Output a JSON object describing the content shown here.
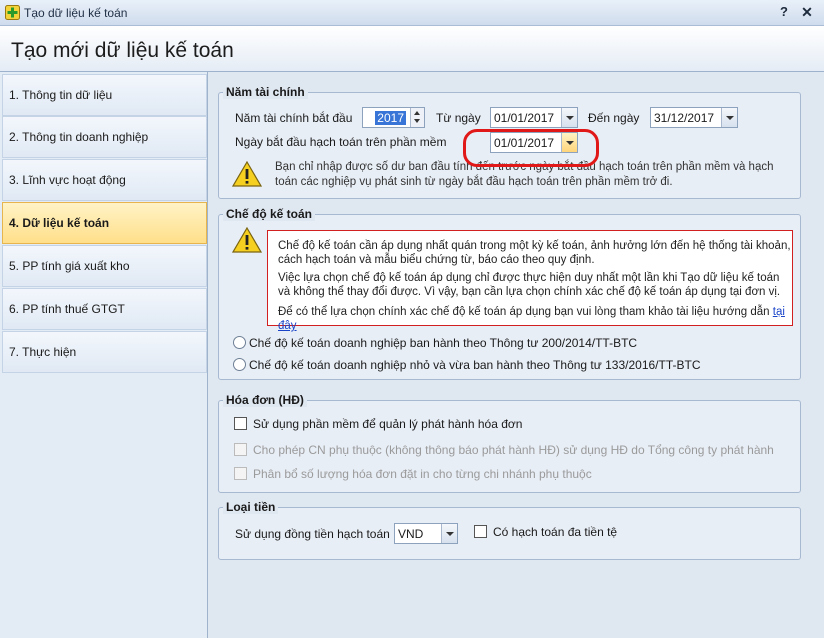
{
  "window": {
    "title": "Tạo dữ liệu kế toán",
    "help": "?",
    "close": "✕"
  },
  "header": {
    "title": "Tạo mới dữ liệu kế toán"
  },
  "steps": [
    {
      "label": "1. Thông tin dữ liệu"
    },
    {
      "label": "2. Thông tin doanh nghiệp"
    },
    {
      "label": "3. Lĩnh vực hoạt động"
    },
    {
      "label": "4. Dữ liệu kế toán"
    },
    {
      "label": "5. PP tính giá xuất kho"
    },
    {
      "label": "6. PP tính thuế GTGT"
    },
    {
      "label": "7. Thực hiện"
    }
  ],
  "fiscal": {
    "title": "Năm tài chính",
    "start_year_label": "Năm tài chính bắt đầu",
    "start_year": "2017",
    "from_label": "Từ ngày",
    "from_date": "01/01/2017",
    "to_label": "Đến ngày",
    "to_date": "31/12/2017",
    "accounting_start_label": "Ngày bắt đầu hạch toán trên phần mềm",
    "accounting_start": "01/01/2017",
    "note_line1": "Bạn chỉ nhập được số dư ban đầu tính đến trước ngày bắt đầu hạch toán trên phần mềm và hạch",
    "note_line2": "toán các nghiệp vụ phát sinh từ ngày bắt đầu hạch toán trên phần mềm trở đi."
  },
  "regime": {
    "title": "Chế độ kế toán",
    "p1_line1": "Chế độ kế toán cần áp dụng nhất quán trong một kỳ kế toán, ảnh hưởng lớn đến hệ thống tài khoản,",
    "p1_line2": "cách hạch toán và mẫu biểu chứng từ, báo cáo theo quy định.",
    "p2_line1": "Việc lựa chọn chế độ kế toán áp dụng chỉ được thực hiện duy nhất một lần khi Tạo dữ liệu kế toán",
    "p2_line2": "và không thể thay đổi được. Vì vậy, bạn cần lựa chọn chính xác chế độ kế toán áp dụng tại đơn vị.",
    "p3": "Để có thể lựa chọn chính xác chế độ kế toán áp dụng bạn vui lòng tham khảo tài liệu hướng dẫn",
    "link": "tại đây",
    "option1": "Chế độ kế toán doanh nghiệp ban hành theo Thông tư 200/2014/TT-BTC",
    "option2": "Chế độ kế toán doanh nghiệp nhỏ và vừa ban hành theo Thông tư 133/2016/TT-BTC"
  },
  "invoice": {
    "title": "Hóa đơn (HĐ)",
    "opt1": "Sử dụng phần mềm để quản lý phát hành hóa đơn",
    "opt2": "Cho phép CN phụ thuộc (không thông báo phát hành HĐ) sử dụng HĐ do Tổng công ty phát hành",
    "opt3": "Phân bổ số lượng hóa đơn đặt in cho từng chi nhánh phụ thuộc"
  },
  "currency": {
    "title": "Loại tiền",
    "label": "Sử dụng đồng tiền hạch toán",
    "value": "VND",
    "multi_label": "Có hạch toán đa tiền tệ"
  }
}
